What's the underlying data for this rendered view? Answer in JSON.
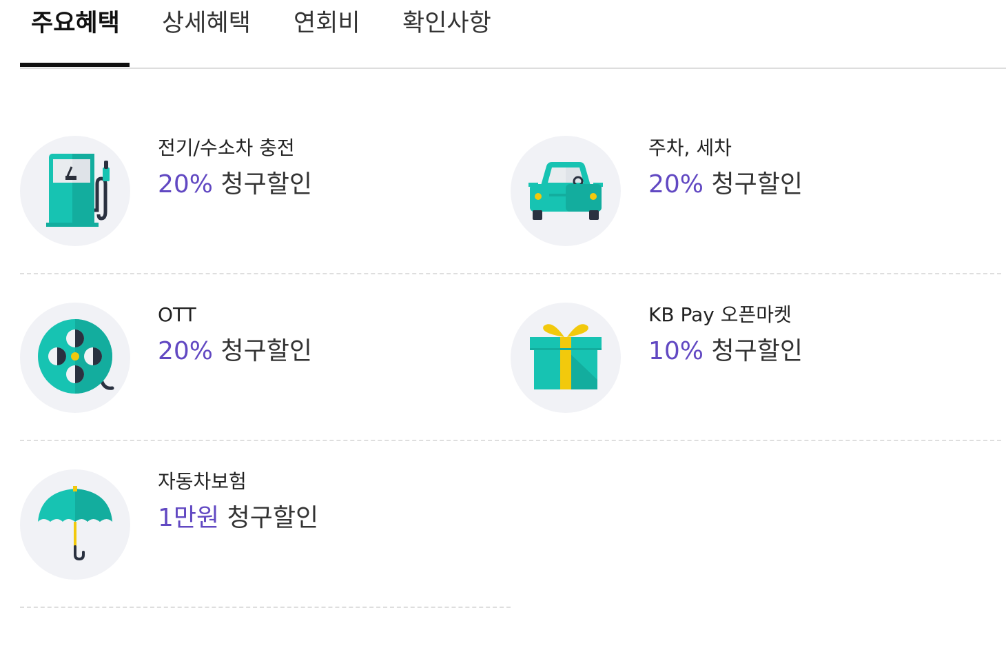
{
  "tabs": [
    {
      "label": "주요혜택",
      "active": true
    },
    {
      "label": "상세혜택",
      "active": false
    },
    {
      "label": "연회비",
      "active": false
    },
    {
      "label": "확인사항",
      "active": false
    }
  ],
  "benefits": [
    {
      "title": "전기/수소차 충전",
      "value": "20%",
      "suffix": "청구할인",
      "icon": "fuel-pump-icon"
    },
    {
      "title": "주차, 세차",
      "value": "20%",
      "suffix": "청구할인",
      "icon": "car-icon"
    },
    {
      "title": "OTT",
      "value": "20%",
      "suffix": "청구할인",
      "icon": "film-reel-icon"
    },
    {
      "title": "KB Pay 오픈마켓",
      "value": "10%",
      "suffix": "청구할인",
      "icon": "gift-box-icon"
    },
    {
      "title": "자동차보험",
      "value": "1만원",
      "suffix": "청구할인",
      "icon": "umbrella-icon"
    }
  ],
  "colors": {
    "accent": "#6148c2",
    "icon_teal": "#17c3b2",
    "icon_bg": "#f1f2f6",
    "active_tab_underline": "#111111"
  }
}
